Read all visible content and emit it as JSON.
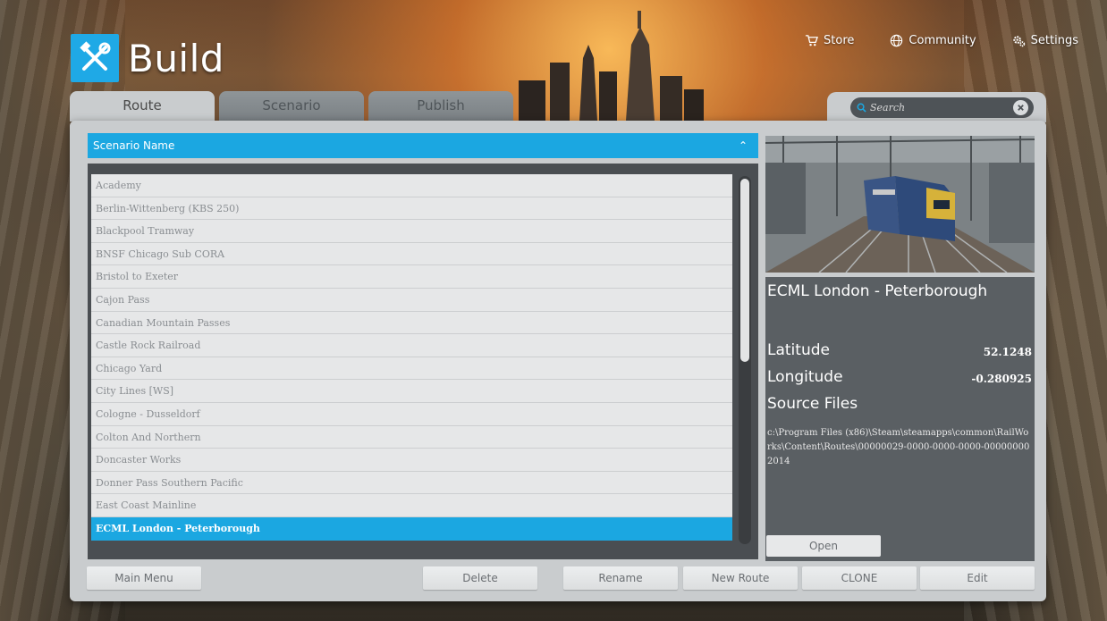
{
  "app": {
    "title": "Build"
  },
  "topnav": [
    {
      "label": "Store",
      "icon": "cart-icon"
    },
    {
      "label": "Community",
      "icon": "globe-icon"
    },
    {
      "label": "Settings",
      "icon": "gears-icon"
    }
  ],
  "tabs": [
    {
      "label": "Route",
      "active": true
    },
    {
      "label": "Scenario",
      "active": false
    },
    {
      "label": "Publish",
      "active": false
    }
  ],
  "search": {
    "placeholder": "Search"
  },
  "list": {
    "header": "Scenario Name",
    "items": [
      "Academy",
      "Berlin-Wittenberg (KBS 250)",
      "Blackpool Tramway",
      "BNSF Chicago Sub CORA",
      "Bristol to Exeter",
      "Cajon Pass",
      "Canadian Mountain Passes",
      "Castle Rock Railroad",
      "Chicago Yard",
      "City Lines [WS]",
      "Cologne - Dusseldorf",
      "Colton And Northern",
      "Doncaster Works",
      "Donner Pass Southern Pacific",
      "East Coast Mainline",
      "ECML London - Peterborough"
    ],
    "selected": "ECML London - Peterborough"
  },
  "detail": {
    "title": "ECML London - Peterborough",
    "latitude_label": "Latitude",
    "latitude_value": "52.1248",
    "longitude_label": "Longitude",
    "longitude_value": "-0.280925",
    "source_label": "Source Files",
    "source_path": "c:\\Program Files (x86)\\Steam\\steamapps\\common\\RailWorks\\Content\\Routes\\00000029-0000-0000-0000-000000002014",
    "open_label": "Open"
  },
  "buttons": {
    "main_menu": "Main Menu",
    "delete": "Delete",
    "rename": "Rename",
    "new_route": "New Route",
    "clone": "CLONE",
    "edit": "Edit"
  },
  "colors": {
    "accent": "#1ba7e1",
    "panel": "#c9ccce",
    "detail_bg": "#5a5f63"
  }
}
